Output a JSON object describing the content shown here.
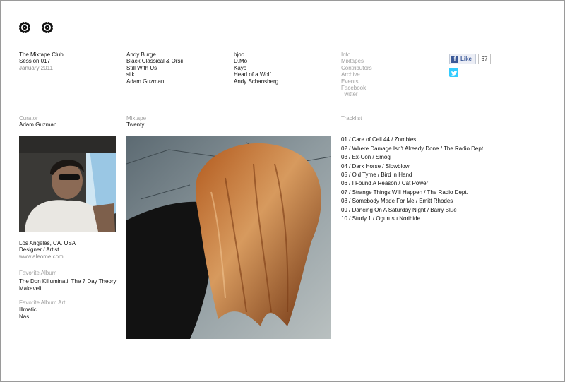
{
  "header": {
    "logo_icons": [
      "vinyl-icon",
      "vinyl-icon"
    ],
    "club_name": "The Mixtape Club",
    "session": "Session 017",
    "date": "January 2011"
  },
  "contributors_col1": [
    "Andy Burge",
    "Black Classical & Orsii",
    "Still With Us",
    "silk",
    "Adam Guzman"
  ],
  "contributors_col2": [
    "bjoo",
    "D.Mo",
    "Kayo",
    "Head of a Wolf",
    "Andy Schansberg"
  ],
  "nav": [
    "Info",
    "Mixtapes",
    "Contributors",
    "Archive",
    "Events",
    "Facebook",
    "Twitter"
  ],
  "social": {
    "like_label": "Like",
    "like_count": "67",
    "facebook_icon": "facebook-icon",
    "twitter_icon": "twitter-icon",
    "colors": {
      "facebook": "#3b5998",
      "twitter": "#33ccff"
    }
  },
  "curator": {
    "heading": "Curator",
    "name": "Adam Guzman",
    "location": "Los Angeles, CA. USA",
    "role": "Designer / Artist",
    "website": "www.aleome.com",
    "favorite_album_heading": "Favorite Album",
    "favorite_album": [
      "The Don Killuminati: The 7 Day Theory",
      "Makaveli"
    ],
    "favorite_album_art_heading": "Favorite Album Art",
    "favorite_album_art": [
      "Illmatic",
      "Nas"
    ]
  },
  "mixtape": {
    "heading": "Mixtape",
    "title": "Twenty"
  },
  "tracklist": {
    "heading": "Tracklist",
    "tracks": [
      "01 / Care of Cell 44 / Zombies",
      "02 / Where Damage Isn't Already Done / The Radio Dept.",
      "03 / Ex-Con / Smog",
      "04 / Dark Horse / Slowblow",
      "05 / Old Tyme / Bird in Hand",
      "06 / I Found A Reason / Cat Power",
      "07 / Strange Things Will Happen / The Radio Dept.",
      "08 / Somebody Made For Me / Emitt Rhodes",
      "09 / Dancing On A Saturday Night / Barry Blue",
      "10 / Study 1 / Ogurusu Norihide"
    ]
  }
}
